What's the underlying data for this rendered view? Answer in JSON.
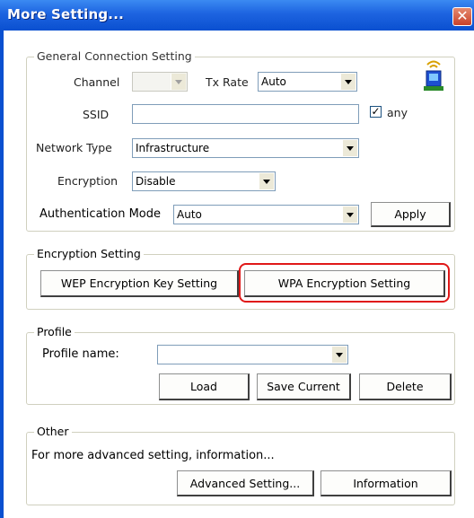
{
  "window": {
    "title": "More Setting...",
    "close_glyph": "✕"
  },
  "general": {
    "legend": "General Connection Setting",
    "channel_label": "Channel",
    "channel_value": "",
    "txrate_label": "Tx Rate",
    "txrate_value": "Auto",
    "ssid_label": "SSID",
    "ssid_value": "",
    "any_checked": "✓",
    "any_label": "any",
    "network_type_label": "Network Type",
    "network_type_value": "Infrastructure",
    "encryption_label": "Encryption",
    "encryption_value": "Disable",
    "auth_mode_label": "Authentication Mode",
    "auth_mode_value": "Auto",
    "apply_label": "Apply",
    "icon_colors": {
      "signal": "#d8a000",
      "device": "#1d4fd0",
      "base": "#2a8a2a"
    }
  },
  "encryption_setting": {
    "legend": "Encryption Setting",
    "wep_label": "WEP Encryption Key Setting",
    "wpa_label": "WPA Encryption Setting",
    "highlight_color": "#e01818"
  },
  "profile": {
    "legend": "Profile",
    "name_label": "Profile name:",
    "name_value": "",
    "load_label": "Load",
    "save_label": "Save Current",
    "delete_label": "Delete"
  },
  "other": {
    "legend": "Other",
    "info_text": "For more advanced setting, information...",
    "advanced_label": "Advanced Setting...",
    "information_label": "Information"
  }
}
